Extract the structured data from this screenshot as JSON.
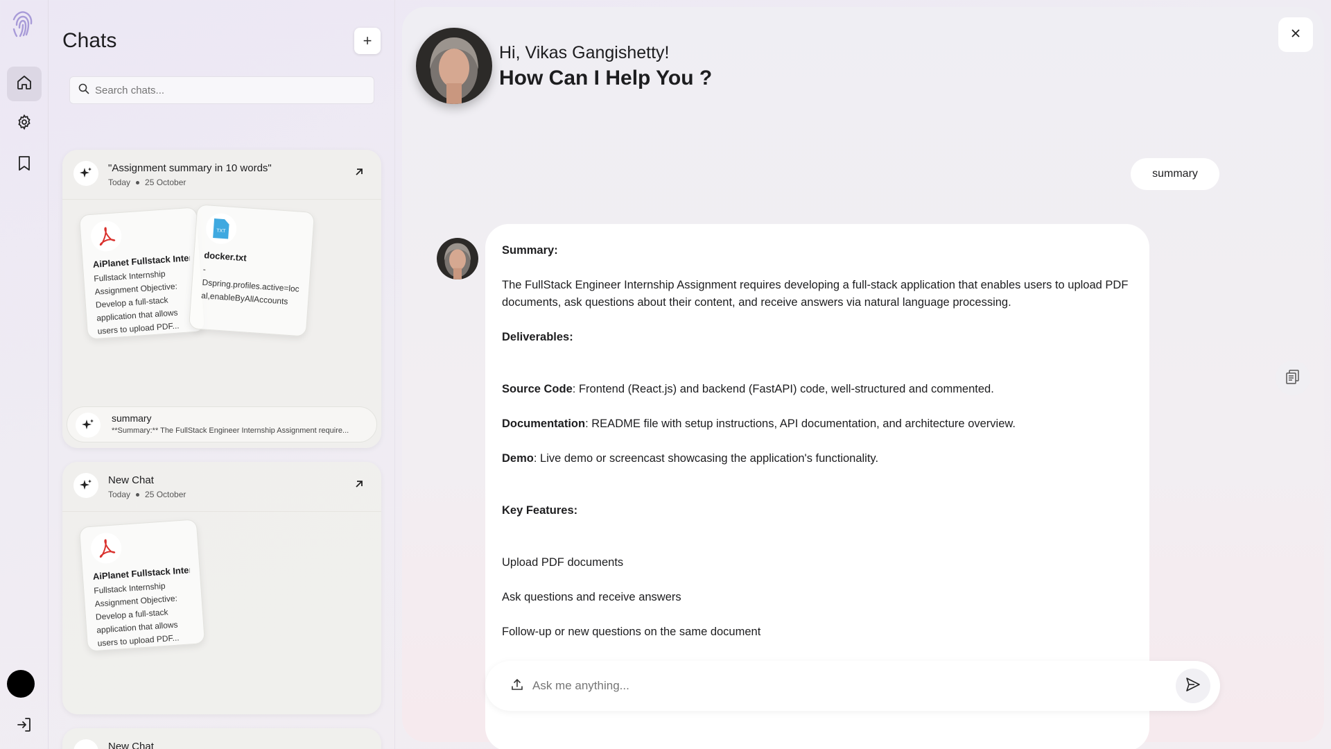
{
  "sidebar": {
    "nav": [
      {
        "name": "home-icon"
      },
      {
        "name": "gear-icon"
      },
      {
        "name": "bookmark-icon"
      }
    ]
  },
  "chats": {
    "title": "Chats",
    "new_button": "+",
    "search_placeholder": "Search chats...",
    "cards": [
      {
        "title": "\"Assignment summary in 10 words\"",
        "date_label": "Today",
        "date": "25 October",
        "docs": [
          {
            "name": "AiPlanet Fullstack Intern...",
            "type": "pdf",
            "text": "Fullstack Internship Assignment Objective: Develop a full-stack application that allows users to upload PDF..."
          },
          {
            "name": "docker.txt",
            "type": "txt",
            "text": "- Dspring.profiles.active=loc al,enableByAllAccounts"
          }
        ],
        "prompt": {
          "title": "summary",
          "subtitle": "**Summary:** The FullStack Engineer Internship Assignment require..."
        }
      },
      {
        "title": "New Chat",
        "date_label": "Today",
        "date": "25 October",
        "docs": [
          {
            "name": "AiPlanet Fullstack Intern...",
            "type": "pdf",
            "text": "Fullstack Internship Assignment Objective: Develop a full-stack application that allows users to upload PDF..."
          }
        ]
      },
      {
        "title": "New Chat"
      }
    ]
  },
  "main": {
    "greeting": "Hi, Vikas Gangishetty!",
    "headline": "How Can I Help You ?",
    "user_message": "summary",
    "answer": {
      "summary_heading": "Summary:",
      "summary_text": "The FullStack Engineer Internship Assignment requires developing a full-stack application that enables users to upload PDF documents, ask questions about their content, and receive answers via natural language processing.",
      "deliverables_heading": "Deliverables:",
      "deliverables": [
        {
          "label": "Source Code",
          "text": ": Frontend (React.js) and backend (FastAPI) code, well-structured and commented."
        },
        {
          "label": "Documentation",
          "text": ": README file with setup instructions, API documentation, and architecture overview."
        },
        {
          "label": "Demo",
          "text": ": Live demo or screencast showcasing the application's functionality."
        }
      ],
      "features_heading": "Key Features:",
      "features": [
        "Upload PDF documents",
        "Ask questions and receive answers",
        "Follow-up or new questions on the same document"
      ]
    },
    "composer_placeholder": "Ask me anything..."
  },
  "colors": {
    "pdf_red": "#d9302c",
    "txt_blue": "#3fa9e0",
    "rail_active": "#dcd7e4"
  }
}
